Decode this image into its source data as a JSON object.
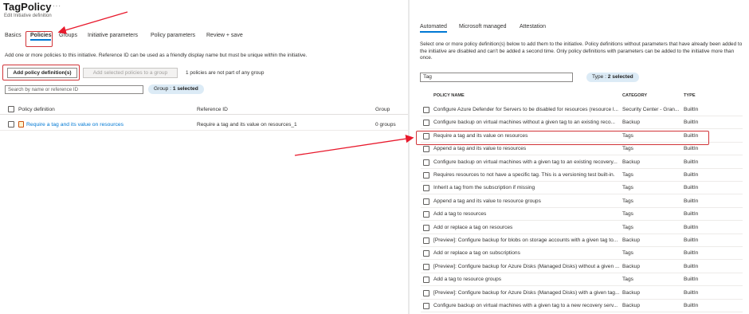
{
  "left": {
    "title": "TagPolicy",
    "more": "···",
    "subtitle": "Edit Initiative definition",
    "tabs": [
      "Basics",
      "Policies",
      "Groups",
      "Initiative parameters",
      "Policy parameters",
      "Review + save"
    ],
    "description": "Add one or more policies to this initiative. Reference ID can be used as a friendly display name but must be unique within the initiative.",
    "add_button": "Add policy definition(s)",
    "add_group_button": "Add selected policies to a group",
    "group_note": "1 policies are not part of any group",
    "search_placeholder": "Search by name or reference ID",
    "group_pill_label": "Group : ",
    "group_pill_value": "1 selected",
    "columns": [
      "Policy definition",
      "Reference ID",
      "Group"
    ],
    "rows": [
      {
        "name": "Require a tag and its value on resources",
        "ref": "Require a tag and its value on resources_1",
        "group": "0 groups"
      }
    ]
  },
  "right": {
    "tabs": [
      "Automated",
      "Microsoft managed",
      "Attestation"
    ],
    "description": "Select one or more policy definition(s) below to add them to the initiative. Policy definitions without parameters that have already been added to the initiative are disabled and can't be added a second time. Only policy definitions with parameters can be added to the initiative more than once.",
    "search_value": "Tag",
    "type_pill_label": "Type : ",
    "type_pill_value": "2 selected",
    "columns": [
      "POLICY NAME",
      "CATEGORY",
      "TYPE"
    ],
    "rows": [
      {
        "name": "Configure Azure Defender for Servers to be disabled for resources (resource l...",
        "cat": "Security Center - Gran...",
        "type": "BuiltIn"
      },
      {
        "name": "Configure backup on virtual machines without a given tag to an existing reco...",
        "cat": "Backup",
        "type": "BuiltIn"
      },
      {
        "name": "Require a tag and its value on resources",
        "cat": "Tags",
        "type": "BuiltIn"
      },
      {
        "name": "Append a tag and its value to resources",
        "cat": "Tags",
        "type": "BuiltIn"
      },
      {
        "name": "Configure backup on virtual machines with a given tag to an existing recovery...",
        "cat": "Backup",
        "type": "BuiltIn"
      },
      {
        "name": "Requires resources to not have a specific tag. This is a versioning test built-in.",
        "cat": "Tags",
        "type": "BuiltIn"
      },
      {
        "name": "Inherit a tag from the subscription if missing",
        "cat": "Tags",
        "type": "BuiltIn"
      },
      {
        "name": "Append a tag and its value to resource groups",
        "cat": "Tags",
        "type": "BuiltIn"
      },
      {
        "name": "Add a tag to resources",
        "cat": "Tags",
        "type": "BuiltIn"
      },
      {
        "name": "Add or replace a tag on resources",
        "cat": "Tags",
        "type": "BuiltIn"
      },
      {
        "name": "[Preview]: Configure backup for blobs on storage accounts with a given tag to...",
        "cat": "Backup",
        "type": "BuiltIn"
      },
      {
        "name": "Add or replace a tag on subscriptions",
        "cat": "Tags",
        "type": "BuiltIn"
      },
      {
        "name": "[Preview]: Configure backup for Azure Disks (Managed Disks) without a given ...",
        "cat": "Backup",
        "type": "BuiltIn"
      },
      {
        "name": "Add a tag to resource groups",
        "cat": "Tags",
        "type": "BuiltIn"
      },
      {
        "name": "[Preview]: Configure backup for Azure Disks (Managed Disks) with a given tag...",
        "cat": "Backup",
        "type": "BuiltIn"
      },
      {
        "name": "Configure backup on virtual machines with a given tag to a new recovery serv...",
        "cat": "Backup",
        "type": "BuiltIn"
      }
    ]
  },
  "colors": {
    "accent": "#0078d4",
    "highlight": "#d13438",
    "pill": "#dcebf6"
  }
}
